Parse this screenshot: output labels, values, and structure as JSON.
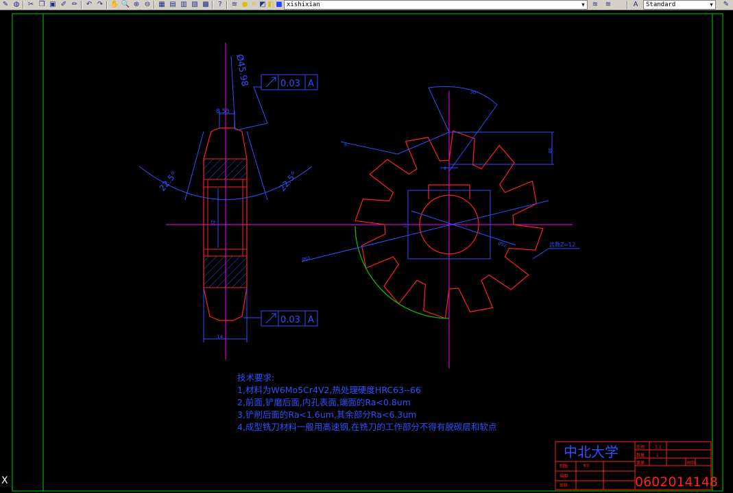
{
  "toolbar": {
    "layer_name": "xishixian",
    "text_style": "Standard",
    "icons": [
      "open-icon",
      "earth-icon",
      "cut-icon",
      "copy-icon",
      "paste-icon",
      "brush-icon",
      "pen-icon",
      "undo-icon",
      "redo-icon",
      "pan-icon",
      "zoom-realtime-icon",
      "zoom-window-icon",
      "zoom-previous-icon",
      "properties-icon",
      "design-center-icon",
      "tool-palette-icon",
      "markup-icon",
      "calc-icon",
      "help-icon",
      "layer-manager-icon",
      "bulb-icon",
      "sun-icon",
      "freeze-icon",
      "lock-icon",
      "color-swatch-icon",
      "layer-previous-icon",
      "layer-states-icon",
      "text-style-icon",
      "edit-icon"
    ]
  },
  "drawing": {
    "dim_diameter": "Ø45.98",
    "dim_width_top": "8.55",
    "dim_angle_left": "22.5°",
    "dim_angle_right": "22.5°",
    "dim_bore": "32",
    "dim_bottom_width": "14",
    "tolerance_top": {
      "value": "0.03",
      "datum": "A"
    },
    "tolerance_bottom": {
      "value": "0.03",
      "datum": "A"
    },
    "dim_angle_circle": "30°",
    "dim_key_height": "36",
    "dim_key_width": "8",
    "dim_radial": "R",
    "dim_bore_small": "16",
    "dim_outer": "Ø65",
    "dim_inner_circle": "Ø32",
    "teeth_note": "齿数Z=12"
  },
  "notes": {
    "title": "技术要求:",
    "lines": [
      "1,材料为W6Mo5Cr4V2,热处理硬度HRC63--66",
      "2,前面,铲磨后面,内孔表面,端面的Ra<0.8um",
      "3,铲削后面的Ra<1.6um,其余部分Ra<6.3um",
      "4,成型铣刀材料一般用高速钢,在铣刀的工作部分不得有脱碳层和软点"
    ]
  },
  "title_block": {
    "school": "中北大学",
    "scale_label": "比例",
    "scale_value": "3:1",
    "qty_label": "数量",
    "qty_value": "1",
    "weight_label": "重量",
    "material_label": "材料",
    "drawn_label": "制图",
    "drawn_name": "李华",
    "design_label": "描图",
    "review_label": "审核",
    "drawing_number": "0602014148"
  },
  "ucs_label": "X",
  "colors": {
    "red": "#ff2020",
    "blue": "#3050ff",
    "magenta": "#ff00ff",
    "green": "#00cc00",
    "white": "#ffffff"
  }
}
